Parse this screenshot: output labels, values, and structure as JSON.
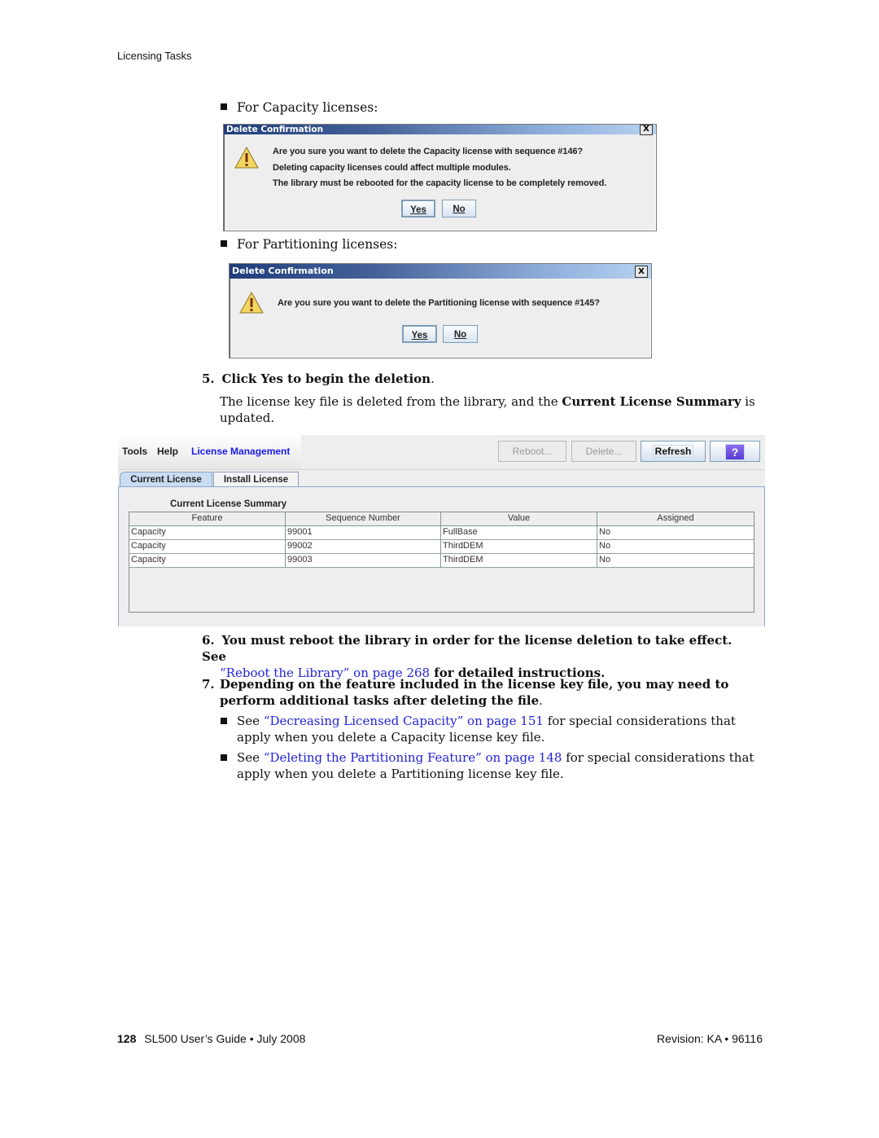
{
  "running_head": "Licensing Tasks",
  "bullets_top": [
    {
      "text": "For Capacity licenses:"
    },
    {
      "text": "For Partitioning licenses:"
    }
  ],
  "dialogs": [
    {
      "title": "Delete Confirmation",
      "close_label": "X",
      "icon": "warning-icon",
      "messages": [
        "Are you sure you want to delete the Capacity license with sequence #146?",
        "Deleting capacity licenses could affect multiple modules.",
        "The library must be rebooted for the capacity license to be completely removed."
      ],
      "yes_label": "Yes",
      "no_label": "No"
    },
    {
      "title": "Delete Confirmation",
      "close_label": "X",
      "icon": "warning-icon",
      "messages": [
        "Are you sure you want to delete the Partitioning license with sequence #145?"
      ],
      "yes_label": "Yes",
      "no_label": "No"
    }
  ],
  "step5": {
    "number": "5.",
    "heading": "Click Yes to begin the deletion",
    "heading_end": ".",
    "para_before": "The license key file is deleted from the library, and the ",
    "para_bold": "Current License Summary",
    "para_after": " is updated."
  },
  "app": {
    "menu": [
      "Tools",
      "Help",
      "License Management"
    ],
    "toolbar": {
      "reboot_label": "Reboot...",
      "delete_label": "Delete...",
      "refresh_label": "Refresh",
      "help_label": "?"
    },
    "tabs": [
      "Current License",
      "Install License"
    ],
    "summary_title": "Current License Summary",
    "table": {
      "columns": [
        "Feature",
        "Sequence Number",
        "Value",
        "Assigned"
      ],
      "rows": [
        [
          "Capacity",
          "99001",
          "FullBase",
          "No"
        ],
        [
          "Capacity",
          "99002",
          "ThirdDEM",
          "No"
        ],
        [
          "Capacity",
          "99003",
          "ThirdDEM",
          "No"
        ]
      ]
    }
  },
  "step6": {
    "number": "6.",
    "text_before": "You must reboot the library in order for the license deletion to take effect. See",
    "link": "“Reboot the Library” on page 268",
    "text_after": " for detailed instructions."
  },
  "step7": {
    "number": "7.",
    "text": "Depending on the feature included in the license key file, you may need to perform additional tasks after deleting the file",
    "text_end": ".",
    "bullets": [
      {
        "prefix": "See ",
        "link": "“Decreasing Licensed Capacity” on page 151",
        "suffix": " for special considerations that apply when you delete a Capacity license key file."
      },
      {
        "prefix": "See ",
        "link": "“Deleting the Partitioning Feature” on page 148",
        "suffix": " for special considerations that apply when you delete a Partitioning license key file."
      }
    ]
  },
  "footer": {
    "page_number": "128",
    "left": "SL500 User’s Guide • July 2008",
    "right": "Revision: KA • 96116"
  }
}
